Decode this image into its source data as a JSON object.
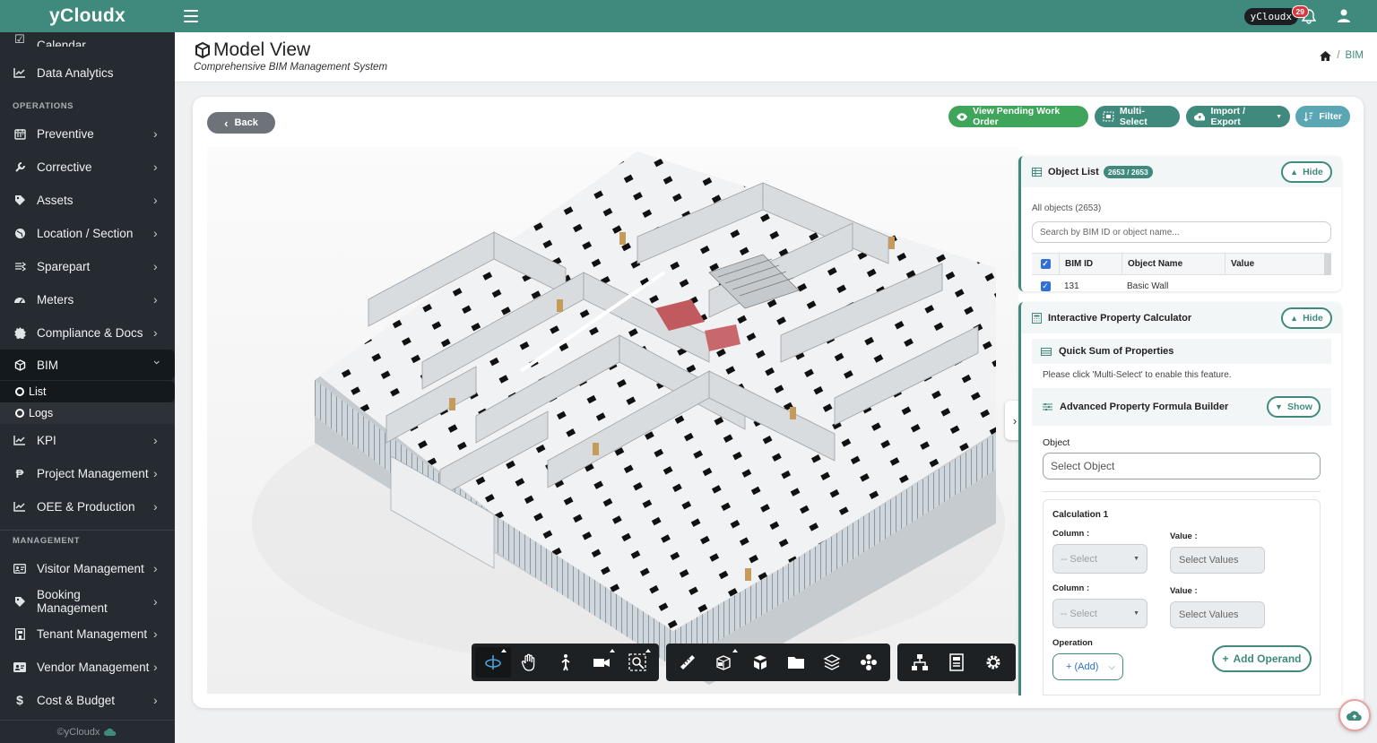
{
  "app": {
    "brand": "yCloudx",
    "footer": "©yCloudx"
  },
  "topbar": {
    "user_chip": "yCloudx",
    "notifications": "29"
  },
  "sidebar": {
    "partial_item": "Calendar",
    "items_top": [
      {
        "label": "Data Analytics",
        "icon": "chart-line-icon"
      }
    ],
    "section_operations": "OPERATIONS",
    "operations": [
      {
        "label": "Preventive",
        "icon": "calendar-icon"
      },
      {
        "label": "Corrective",
        "icon": "wrench-icon"
      },
      {
        "label": "Assets",
        "icon": "tag-icon"
      },
      {
        "label": "Location / Section",
        "icon": "globe-icon"
      },
      {
        "label": "Sparepart",
        "icon": "parts-icon"
      },
      {
        "label": "Meters",
        "icon": "gauge-icon"
      },
      {
        "label": "Compliance & Docs",
        "icon": "certificate-icon"
      },
      {
        "label": "BIM",
        "icon": "cube-icon"
      }
    ],
    "bim_sub": [
      {
        "label": "List"
      },
      {
        "label": "Logs"
      }
    ],
    "operations_after": [
      {
        "label": "KPI",
        "icon": "chart-line-icon"
      },
      {
        "label": "Project Management",
        "icon": "project-icon"
      },
      {
        "label": "OEE & Production",
        "icon": "chart-line-icon"
      }
    ],
    "section_management": "MANAGEMENT",
    "management": [
      {
        "label": "Visitor Management",
        "icon": "id-card-icon"
      },
      {
        "label": "Booking Management",
        "icon": "tag-icon"
      },
      {
        "label": "Tenant Management",
        "icon": "building-icon"
      },
      {
        "label": "Vendor Management",
        "icon": "vendor-card-icon"
      },
      {
        "label": "Cost & Budget",
        "icon": "dollar-icon"
      }
    ]
  },
  "header": {
    "title": "Model View",
    "subtitle": "Comprehensive BIM Management System",
    "breadcrumb_current": "BIM"
  },
  "actions": {
    "back": "Back",
    "pending": "View Pending Work Order",
    "multi": "Multi-Select",
    "impexp": "Import / Export",
    "filter": "Filter"
  },
  "object_list": {
    "title": "Object List",
    "count": "2653 / 2653",
    "hide": "Hide",
    "all_objects": "All objects (2653)",
    "search_placeholder": "Search by BIM ID or object name...",
    "columns": [
      "BIM ID",
      "Object Name",
      "Value"
    ],
    "first_row": {
      "id": "131",
      "name": "Basic Wall"
    }
  },
  "calculator": {
    "title": "Interactive Property Calculator",
    "hide": "Hide",
    "quick_sum": "Quick Sum of Properties",
    "quick_hint": "Please click 'Multi-Select' to enable this feature.",
    "advanced": "Advanced Property Formula Builder",
    "show": "Show",
    "object_label": "Object",
    "object_placeholder": "Select Object",
    "calc_title": "Calculation 1",
    "column_label": "Column :",
    "value_label": "Value :",
    "select_placeholder": "-- Select",
    "value_placeholder": "Select Values",
    "operation_label": "Operation",
    "add_dropdown": "+ (Add)",
    "add_operand": "Add Operand"
  },
  "toolbar": {
    "group1": [
      "orbit-icon",
      "pan-icon",
      "walk-icon",
      "camera-icon",
      "zoom-fit-icon"
    ],
    "group2": [
      "measure-icon",
      "section-icon",
      "explode-icon",
      "folder-icon",
      "layers-icon",
      "modelbrowser-icon"
    ],
    "group3": [
      "structure-icon",
      "properties-icon",
      "settings-icon"
    ]
  },
  "colors": {
    "brand": "#3f8a7d",
    "sidebar": "#262b31",
    "success": "#3fa55a",
    "filter": "#5aa6b3"
  }
}
